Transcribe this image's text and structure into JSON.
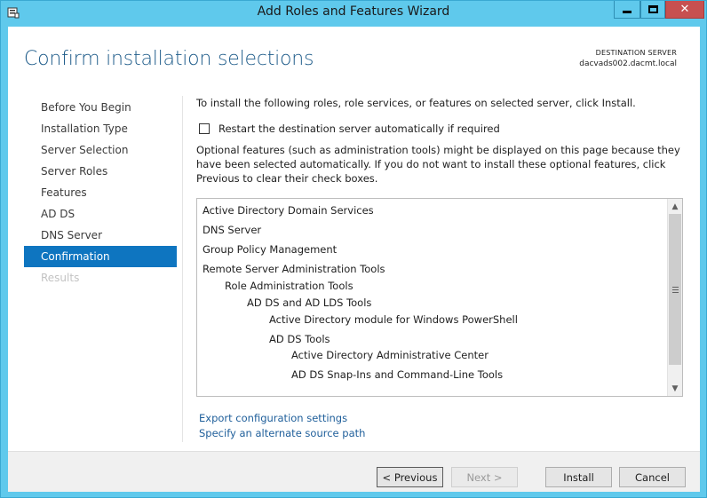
{
  "window": {
    "title": "Add Roles and Features Wizard",
    "icon": "server-manager-icon",
    "controls": {
      "minimize": "minimize-icon",
      "maximize": "maximize-icon",
      "close": "✕"
    }
  },
  "header": {
    "title": "Confirm installation selections",
    "destination_label": "DESTINATION SERVER",
    "destination_value": "dacvads002.dacmt.local"
  },
  "nav": {
    "items": [
      {
        "label": "Before You Begin",
        "state": "normal"
      },
      {
        "label": "Installation Type",
        "state": "normal"
      },
      {
        "label": "Server Selection",
        "state": "normal"
      },
      {
        "label": "Server Roles",
        "state": "normal"
      },
      {
        "label": "Features",
        "state": "normal"
      },
      {
        "label": "AD DS",
        "state": "normal"
      },
      {
        "label": "DNS Server",
        "state": "normal"
      },
      {
        "label": "Confirmation",
        "state": "active"
      },
      {
        "label": "Results",
        "state": "disabled"
      }
    ]
  },
  "content": {
    "intro": "To install the following roles, role services, or features on selected server, click Install.",
    "restart_label": "Restart the destination server automatically if required",
    "restart_checked": false,
    "optional_note": "Optional features (such as administration tools) might be displayed on this page because they have been selected automatically. If you do not want to install these optional features, click Previous to clear their check boxes.",
    "features": [
      {
        "label": "Active Directory Domain Services",
        "level": 0
      },
      {
        "label": "DNS Server",
        "level": 0
      },
      {
        "label": "Group Policy Management",
        "level": 0
      },
      {
        "label": "Remote Server Administration Tools",
        "level": 0
      },
      {
        "label": "Role Administration Tools",
        "level": 1
      },
      {
        "label": "AD DS and AD LDS Tools",
        "level": 2
      },
      {
        "label": "Active Directory module for Windows PowerShell",
        "level": 3
      },
      {
        "label": "AD DS Tools",
        "level": 3
      },
      {
        "label": "Active Directory Administrative Center",
        "level": 4
      },
      {
        "label": "AD DS Snap-Ins and Command-Line Tools",
        "level": 4
      }
    ],
    "links": {
      "export": "Export configuration settings",
      "alternate_source": "Specify an alternate source path"
    }
  },
  "footer": {
    "previous": "< Previous",
    "next": "Next >",
    "install": "Install",
    "cancel": "Cancel"
  },
  "colors": {
    "titlebar": "#5fc9ec",
    "close_button": "#c75050",
    "heading": "#1f5c8a",
    "nav_active": "#0e75c0",
    "link": "#1e5e9a"
  }
}
